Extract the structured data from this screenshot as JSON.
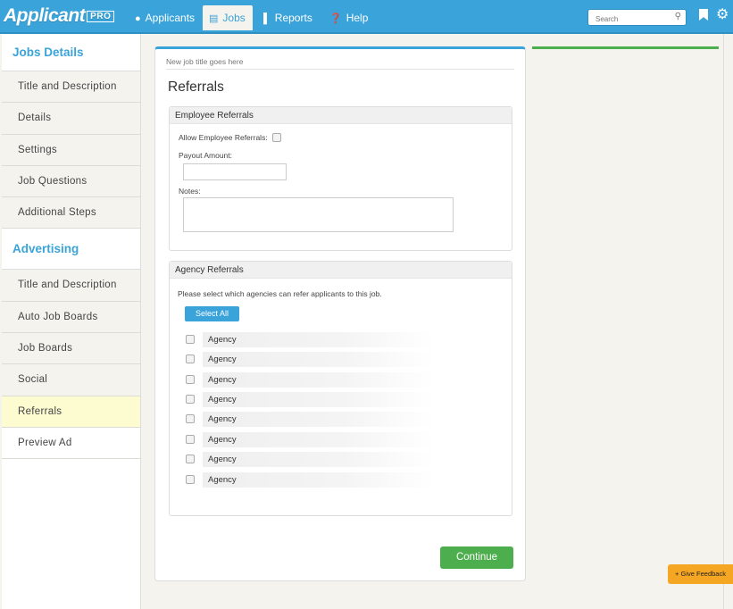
{
  "brand": {
    "name": "Applicant",
    "badge": "PRO"
  },
  "nav": [
    {
      "icon": "user-icon",
      "label": "Applicants"
    },
    {
      "icon": "document-icon",
      "label": "Jobs"
    },
    {
      "icon": "bar-chart-icon",
      "label": "Reports"
    },
    {
      "icon": "question-icon",
      "label": "Help"
    }
  ],
  "search": {
    "placeholder": "Search"
  },
  "sidebar": {
    "jobs_details": {
      "title": "Jobs Details",
      "items": [
        "Title and Description",
        "Details",
        "Settings",
        "Job Questions",
        "Additional Steps"
      ]
    },
    "advertising": {
      "title": "Advertising",
      "items": [
        "Title and Description",
        "Auto Job Boards",
        "Job Boards",
        "Social",
        "Referrals",
        "Preview Ad"
      ],
      "selected": "Referrals"
    }
  },
  "main": {
    "job_title": "New job title goes here",
    "page_title": "Referrals",
    "employee_referrals": {
      "header": "Employee Referrals",
      "allow_label": "Allow Employee Referrals:",
      "payout_label": "Payout Amount:",
      "payout_value": "",
      "notes_label": "Notes:",
      "notes_value": ""
    },
    "agency_referrals": {
      "header": "Agency Referrals",
      "instructions": "Please select which agencies can refer applicants to this job.",
      "select_all_label": "Select All",
      "agencies": [
        "Agency",
        "Agency",
        "Agency",
        "Agency",
        "Agency",
        "Agency",
        "Agency",
        "Agency"
      ]
    },
    "continue_label": "Continue"
  },
  "feedback_label": "+ Give Feedback",
  "colors": {
    "accent": "#3aa3d9",
    "success": "#4cae4c",
    "selected_bg": "#fdfbd0",
    "feedback": "#f5a623"
  }
}
